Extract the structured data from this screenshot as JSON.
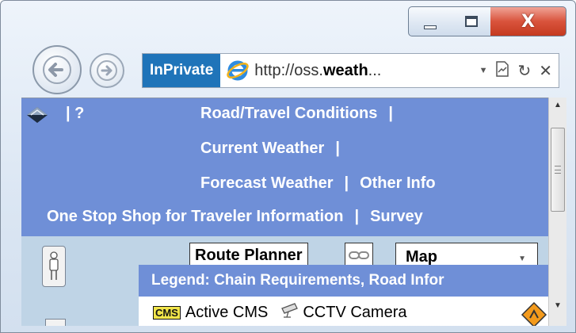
{
  "window": {
    "minimize_icon": "minimize-icon",
    "maximize_icon": "maximize-icon",
    "close_label": "X"
  },
  "navigation": {
    "back_icon": "back-arrow-icon",
    "forward_icon": "forward-arrow-icon"
  },
  "addressbar": {
    "inprivate_label": "InPrivate",
    "url_prefix": "http://oss.",
    "url_bold": "weath",
    "url_suffix": "...",
    "site_icon": "internet-explorer-icon",
    "tools": [
      "dropdown-arrow-icon",
      "compatibility-view-icon",
      "refresh-icon",
      "stop-icon"
    ]
  },
  "page": {
    "help_label": "| ?",
    "nav_links": {
      "road_travel": "Road/Travel Conditions",
      "current_weather": "Current Weather",
      "forecast_weather": "Forecast Weather",
      "other_info": "Other Info",
      "one_stop_shop": "One Stop Shop for Traveler Information",
      "survey": "Survey",
      "separator": "|"
    },
    "map": {
      "route_planner_label": "Route Planner",
      "map_type_selected": "Map",
      "legend_title": "Legend: Chain Requirements, Road Infor",
      "legend_items": {
        "cms_badge": "CMS",
        "active_cms": "Active CMS",
        "cctv_camera": "CCTV Camera"
      }
    }
  },
  "colors": {
    "header_band": "#6f8fd7",
    "inprivate_bg": "#1f74b9",
    "close_button": "#d9533c"
  }
}
